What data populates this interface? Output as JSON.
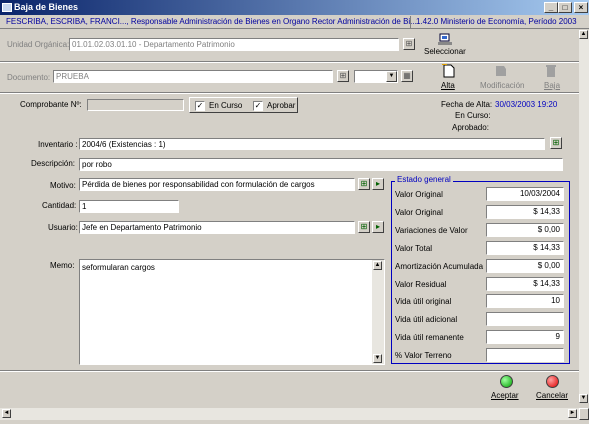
{
  "window": {
    "title": "Baja de Bienes",
    "controls": {
      "minimize": "_",
      "maximize": "□",
      "close": "×"
    }
  },
  "infobar": {
    "left": "FESCRIBA, ESCRIBA, FRANCI..., Responsable Administración de Bienes en Organo Rector Administración de Bi...",
    "right": "1.42.0 Ministerio de Economía, Período 2003"
  },
  "unidad": {
    "label": "Unidad Orgánica:",
    "value": "01.01.02.03.01.10 - Departamento Patrimonio",
    "select_label": "Seleccionar"
  },
  "documento": {
    "label": "Documento:",
    "value": "PRUEBA",
    "alta_label": "Alta",
    "modificacion_label": "Modificación",
    "baja_label": "Baja"
  },
  "comprobante": {
    "label": "Comprobante Nº:",
    "value": "",
    "en_curso_label": "En Curso",
    "aprobar_label": "Aprobar",
    "en_curso_checked": "✓",
    "aprobar_checked": "✓"
  },
  "fechas": {
    "alta_label": "Fecha de Alta:",
    "alta_value": "30/03/2003 19:20",
    "en_curso_label": "En Curso:",
    "aprobado_label": "Aprobado:"
  },
  "form": {
    "inventario_label": "Inventario :",
    "inventario_value": "2004/6  (Existencias : 1)",
    "descripcion_label": "Descripción:",
    "descripcion_value": "por robo",
    "motivo_label": "Motivo:",
    "motivo_value": "Pérdida de bienes por responsabilidad con formulación de cargos",
    "cantidad_label": "Cantidad:",
    "cantidad_value": "1",
    "usuario_label": "Usuario:",
    "usuario_value": "Jefe en Departamento Patrimonio",
    "memo_label": "Memo:",
    "memo_value": "seformularan cargos"
  },
  "estado": {
    "legend": "Estado general",
    "rows": [
      {
        "label": "Valor Original",
        "value": "10/03/2004"
      },
      {
        "label": "Valor Original",
        "value": "$ 14,33"
      },
      {
        "label": "Variaciones de Valor",
        "value": "$ 0,00"
      },
      {
        "label": "Valor Total",
        "value": "$ 14,33"
      },
      {
        "label": "Amortización Acumulada",
        "value": "$ 0,00"
      },
      {
        "label": "Valor Residual",
        "value": "$ 14,33"
      },
      {
        "label": "Vida útil original",
        "value": "10"
      },
      {
        "label": "Vida útil adicional",
        "value": ""
      },
      {
        "label": "Vida útil remanente",
        "value": "9"
      },
      {
        "label": "% Valor Terreno",
        "value": ""
      }
    ]
  },
  "footer": {
    "aceptar_label": "Aceptar",
    "cancelar_label": "Cancelar"
  },
  "colors": {
    "title_start": "#0a246a",
    "info_text": "#0000a0",
    "accent_blue": "#0000c0",
    "aceptar": "#00a000",
    "cancelar": "#e00000"
  }
}
